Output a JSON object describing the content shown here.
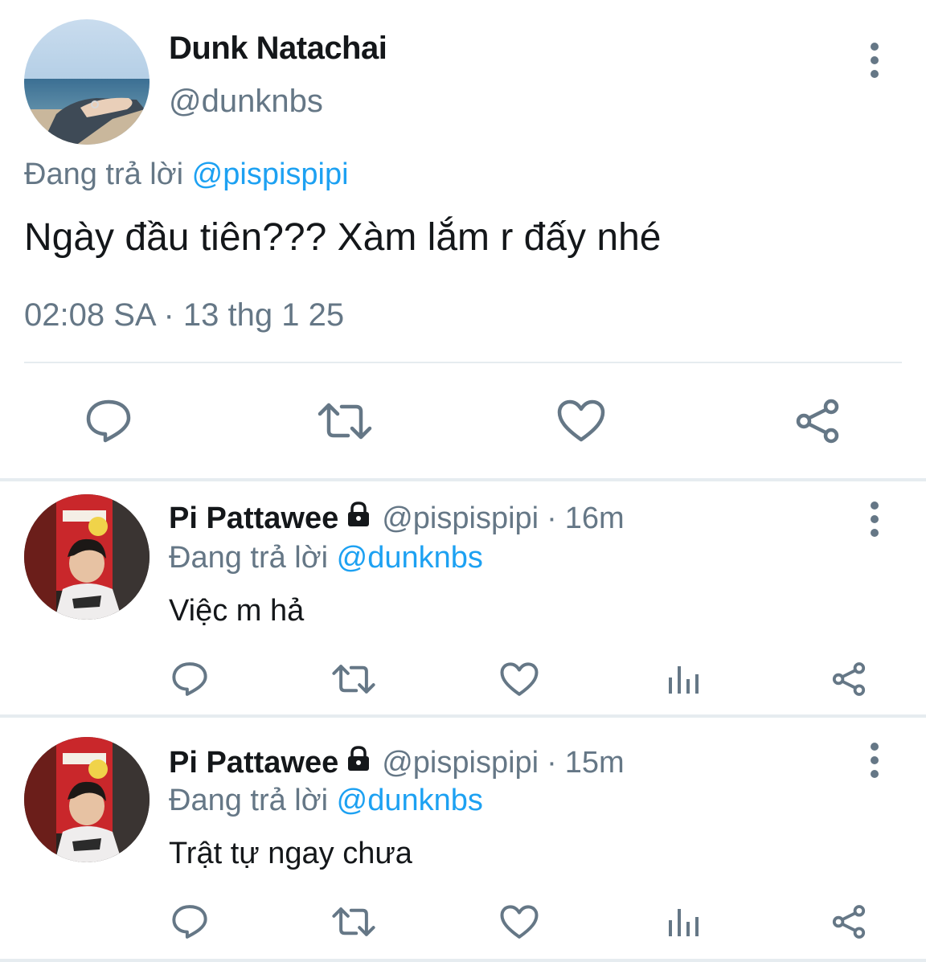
{
  "main_tweet": {
    "author_name": "Dunk Natachai",
    "author_handle": "@dunknbs",
    "reply_prefix": "Đang trả lời",
    "reply_to": "@pispispipi",
    "text": "Ngày đầu tiên??? Xàm lắm r đấy nhé",
    "timestamp": "02:08 SA · 13 thg 1 25",
    "actions": [
      "reply-icon",
      "retweet-icon",
      "like-icon",
      "share-icon"
    ]
  },
  "replies": [
    {
      "author_name": "Pi Pattawee",
      "author_handle": "@pispispipi",
      "separator": "·",
      "time": "16m",
      "reply_prefix": "Đang trả lời",
      "reply_to": "@dunknbs",
      "text": "Việc m hả",
      "actions": [
        "reply-icon",
        "retweet-icon",
        "like-icon",
        "analytics-icon",
        "share-icon"
      ]
    },
    {
      "author_name": "Pi Pattawee",
      "author_handle": "@pispispipi",
      "separator": "·",
      "time": "15m",
      "reply_prefix": "Đang trả lời",
      "reply_to": "@dunknbs",
      "text": "Trật tự ngay chưa",
      "actions": [
        "reply-icon",
        "retweet-icon",
        "like-icon",
        "analytics-icon",
        "share-icon"
      ]
    }
  ],
  "colors": {
    "text": "#14171a",
    "secondary": "#657786",
    "link": "#1da1f2",
    "divider": "#e6ecf0"
  }
}
